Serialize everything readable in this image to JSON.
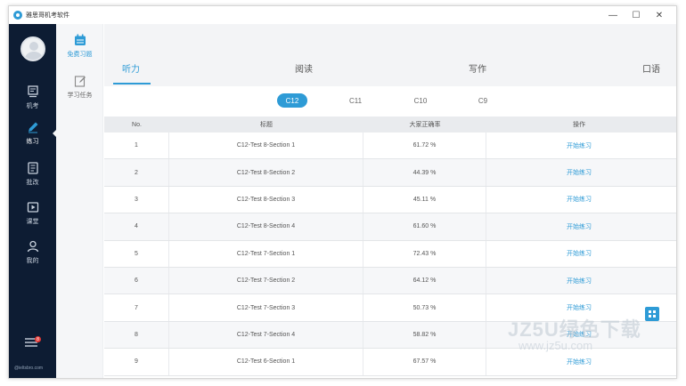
{
  "window": {
    "title": "雅思哥机考软件",
    "controls": {
      "minimize": "—",
      "maximize": "☐",
      "close": "✕"
    }
  },
  "sidebar": {
    "items": [
      {
        "label": "机考",
        "icon": "computer-icon",
        "active": false
      },
      {
        "label": "练习",
        "icon": "pencil-icon",
        "active": true
      },
      {
        "label": "批改",
        "icon": "document-icon",
        "active": false
      },
      {
        "label": "课堂",
        "icon": "play-icon",
        "active": false
      },
      {
        "label": "我的",
        "icon": "user-icon",
        "active": false
      }
    ],
    "notification_count": "8",
    "footer": "@ieltsbro.com"
  },
  "subnav": {
    "items": [
      {
        "label": "免费习题",
        "icon": "calendar-icon",
        "active": true
      },
      {
        "label": "学习任务",
        "icon": "edit-note-icon",
        "active": false
      }
    ]
  },
  "tabs": [
    {
      "label": "听力",
      "active": true
    },
    {
      "label": "阅读",
      "active": false
    },
    {
      "label": "写作",
      "active": false
    },
    {
      "label": "口语",
      "active": false
    }
  ],
  "books": [
    {
      "label": "C12",
      "active": true
    },
    {
      "label": "C11",
      "active": false
    },
    {
      "label": "C10",
      "active": false
    },
    {
      "label": "C9",
      "active": false
    }
  ],
  "table": {
    "headers": {
      "no": "No.",
      "title": "标题",
      "rate": "大家正确率",
      "op": "操作"
    },
    "rows": [
      {
        "no": "1",
        "title": "C12-Test 8-Section 1",
        "rate": "61.72 %",
        "op": "开始练习"
      },
      {
        "no": "2",
        "title": "C12-Test 8-Section 2",
        "rate": "44.39 %",
        "op": "开始练习"
      },
      {
        "no": "3",
        "title": "C12-Test 8-Section 3",
        "rate": "45.11 %",
        "op": "开始练习"
      },
      {
        "no": "4",
        "title": "C12-Test 8-Section 4",
        "rate": "61.60 %",
        "op": "开始练习"
      },
      {
        "no": "5",
        "title": "C12-Test 7-Section 1",
        "rate": "72.43 %",
        "op": "开始练习"
      },
      {
        "no": "6",
        "title": "C12-Test 7-Section 2",
        "rate": "64.12 %",
        "op": "开始练习"
      },
      {
        "no": "7",
        "title": "C12-Test 7-Section 3",
        "rate": "50.73 %",
        "op": "开始练习"
      },
      {
        "no": "8",
        "title": "C12-Test 7-Section 4",
        "rate": "58.82 %",
        "op": "开始练习"
      },
      {
        "no": "9",
        "title": "C12-Test 6-Section 1",
        "rate": "67.57 %",
        "op": "开始练习"
      }
    ]
  },
  "watermark": {
    "line1": "JZ5U绿色下载",
    "line2": "www.jz5u.com"
  },
  "colors": {
    "accent": "#2e9bd6",
    "sidebar_bg": "#0d1c33",
    "tab_bg": "#f3f4f6"
  }
}
